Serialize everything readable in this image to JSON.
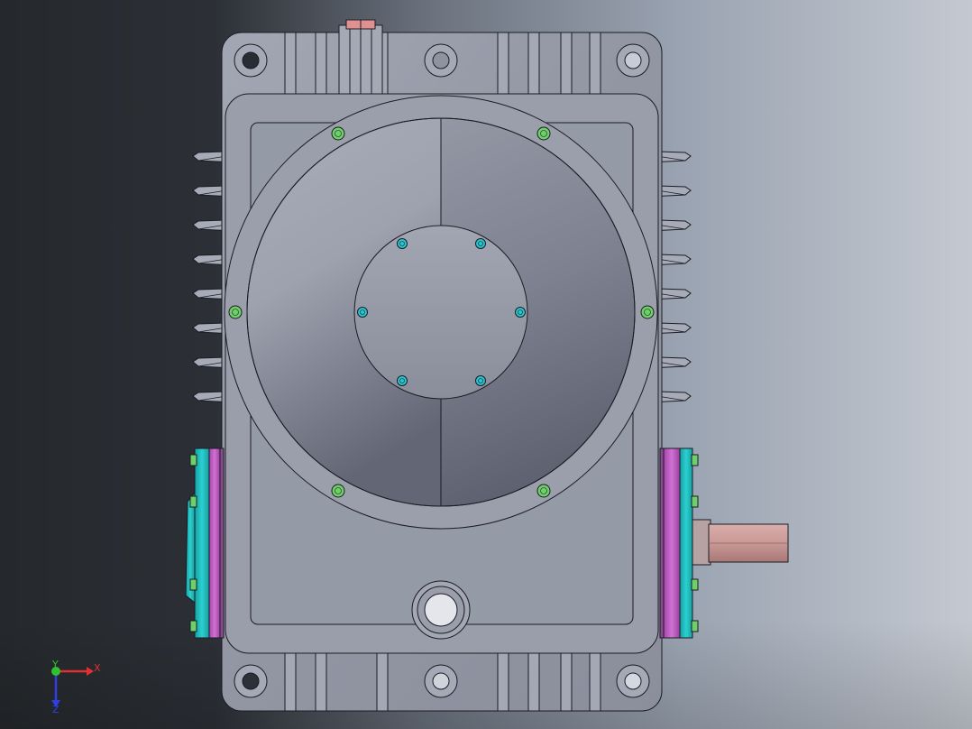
{
  "viewport": {
    "background_dark": "#25282c",
    "background_light": "#c4c9d1"
  },
  "model": {
    "housing_color": "#9599a6",
    "housing_edge": "#1a1c22",
    "fin_color": "#a7abb8",
    "cover_left_color": "#a2a6b3",
    "cover_right_color": "#6f7382",
    "bolt_green": "#6fcf6a",
    "bolt_cyan": "#2bc4cf",
    "flange_teal": "#1fb9b9",
    "flange_magenta": "#c25fc6",
    "shaft_color": "#c99996",
    "plug_color": "#e09090"
  },
  "triad": {
    "x_label": "X",
    "y_label": "Y",
    "z_label": "Z",
    "x_color": "#e03030",
    "y_color": "#30c030",
    "z_color": "#3040e0",
    "x_icon": "x-axis-arrow-icon",
    "y_icon": "y-axis-arrow-icon",
    "z_icon": "z-axis-arrow-icon"
  }
}
